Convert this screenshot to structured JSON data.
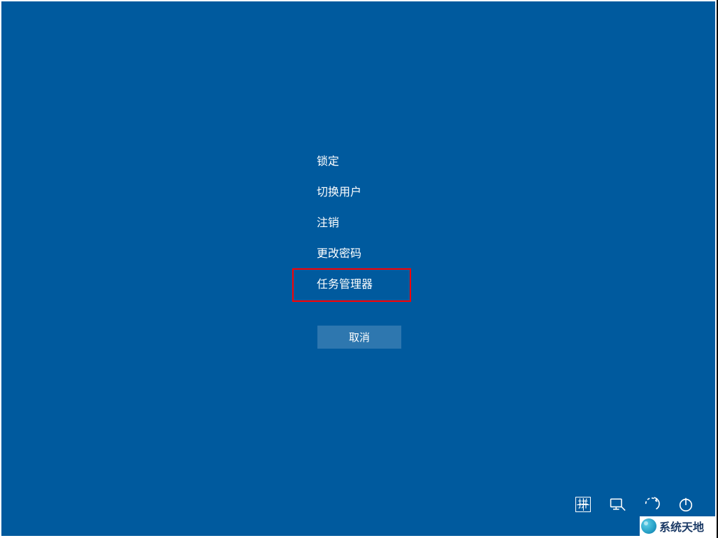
{
  "menu": {
    "items": [
      {
        "label": "锁定",
        "name": "lock-option"
      },
      {
        "label": "切换用户",
        "name": "switch-user-option"
      },
      {
        "label": "注销",
        "name": "sign-out-option"
      },
      {
        "label": "更改密码",
        "name": "change-password-option"
      },
      {
        "label": "任务管理器",
        "name": "task-manager-option",
        "highlighted": true
      }
    ],
    "cancel_label": "取消"
  },
  "tray": {
    "ime_label": "拼",
    "icons": {
      "ime": "ime-icon",
      "network": "network-icon",
      "accessibility": "ease-of-access-icon",
      "power": "power-icon"
    }
  },
  "watermark": {
    "text": "系统天地"
  },
  "colors": {
    "background": "#005a9e",
    "highlight": "#ff0000",
    "cancel_bg": "rgba(255,255,255,0.18)"
  }
}
